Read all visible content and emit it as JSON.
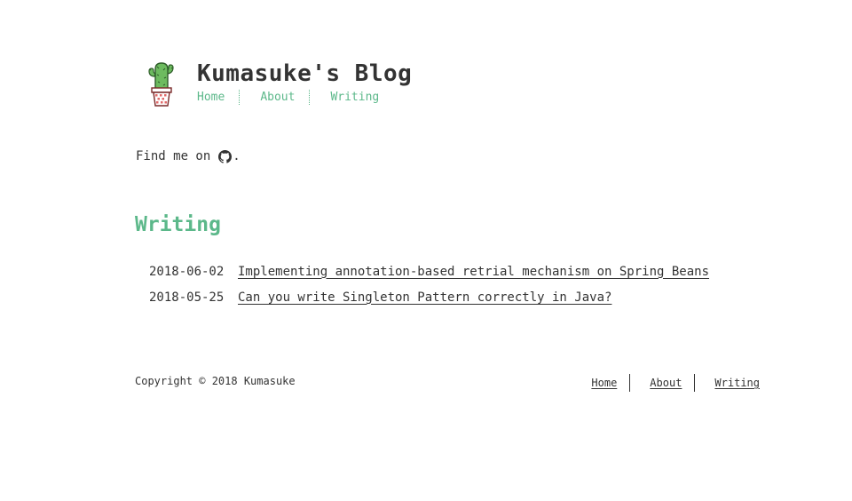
{
  "header": {
    "logo_icon": "cactus-in-pot-icon",
    "title": "Kumasuke's Blog",
    "nav": [
      {
        "label": "Home"
      },
      {
        "label": "About"
      },
      {
        "label": "Writing"
      }
    ]
  },
  "intro": {
    "text": "Find me on",
    "icon": "github-icon",
    "suffix": "."
  },
  "writing": {
    "title": "Writing",
    "posts": [
      {
        "date": "2018-06-02",
        "title": "Implementing annotation-based retrial mechanism on Spring Beans"
      },
      {
        "date": "2018-05-25",
        "title": "Can you write Singleton Pattern correctly in Java?"
      }
    ]
  },
  "footer": {
    "copyright": "Copyright © 2018 Kumasuke",
    "nav": [
      {
        "label": "Home"
      },
      {
        "label": "About"
      },
      {
        "label": "Writing"
      }
    ]
  },
  "colors": {
    "accent": "#5cb88a",
    "text": "#333333",
    "background": "#ffffff"
  }
}
